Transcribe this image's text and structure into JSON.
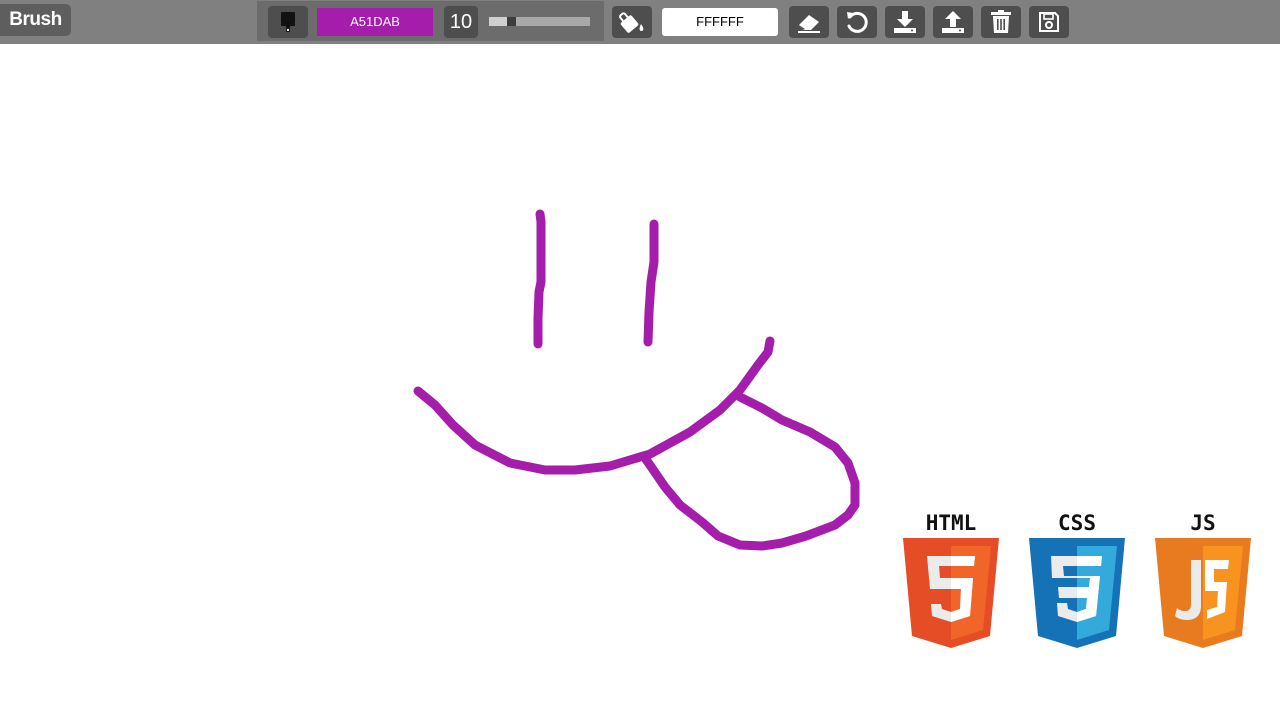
{
  "toolbar": {
    "mode_label": "Brush",
    "brush_color_value": "A51DAB",
    "brush_color_hex": "#A51DAB",
    "brush_size": "10",
    "brush_size_fraction": 0.2,
    "background_color_value": "FFFFFF",
    "background_color_hex": "#FFFFFF",
    "icons": {
      "brush": "paintbrush-icon",
      "fill": "paint-bucket-icon",
      "eraser": "eraser-icon",
      "undo": "undo-icon",
      "download": "download-icon",
      "upload": "upload-icon",
      "clear": "trash-icon",
      "save": "floppy-disk-icon"
    }
  },
  "canvas": {
    "stroke_color": "#A51DAB",
    "drawing": "smiley face with tongue"
  },
  "logos": [
    {
      "title": "HTML",
      "glyph": "5",
      "color": "#E44D26"
    },
    {
      "title": "CSS",
      "glyph": "3",
      "color": "#1572B6"
    },
    {
      "title": "JS",
      "glyph": "JS",
      "color": "#F7931E"
    }
  ]
}
